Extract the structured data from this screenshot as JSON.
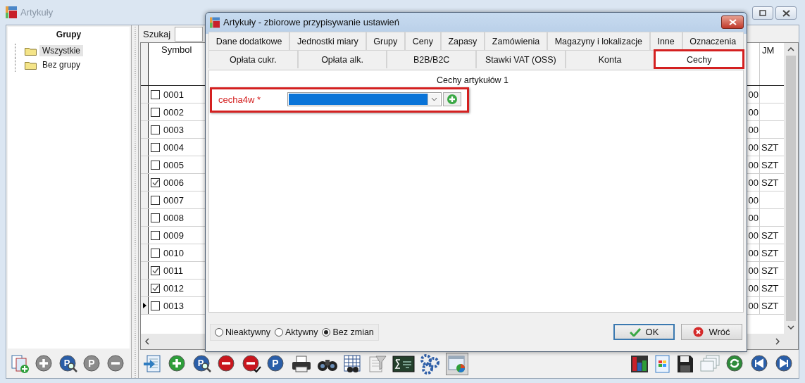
{
  "main_window": {
    "title": "Artykuły"
  },
  "groups_panel": {
    "title": "Grupy",
    "tree": [
      {
        "label": "Wszystkie",
        "selected": true
      },
      {
        "label": "Bez grupy",
        "selected": false
      }
    ]
  },
  "search": {
    "label": "Szukaj"
  },
  "table": {
    "columns": [
      "Symbol",
      "JM"
    ],
    "rows": [
      {
        "checked": false,
        "current": false,
        "symbol": "0001",
        "column_cut": "00"
      },
      {
        "checked": false,
        "current": false,
        "symbol": "0002",
        "column_cut": "00"
      },
      {
        "checked": false,
        "current": false,
        "symbol": "0003",
        "column_cut": "00"
      },
      {
        "checked": false,
        "current": false,
        "symbol": "0004",
        "column_cut": "00",
        "jm": "SZT"
      },
      {
        "checked": false,
        "current": false,
        "symbol": "0005",
        "column_cut": "00",
        "jm": "SZT"
      },
      {
        "checked": true,
        "current": false,
        "symbol": "0006",
        "column_cut": "00",
        "jm": "SZT"
      },
      {
        "checked": false,
        "current": false,
        "symbol": "0007",
        "column_cut": "00"
      },
      {
        "checked": false,
        "current": false,
        "symbol": "0008",
        "column_cut": "00"
      },
      {
        "checked": false,
        "current": false,
        "symbol": "0009",
        "column_cut": "00",
        "jm": "SZT"
      },
      {
        "checked": false,
        "current": false,
        "symbol": "0010",
        "column_cut": "00",
        "jm": "SZT"
      },
      {
        "checked": true,
        "current": false,
        "symbol": "0011",
        "column_cut": "00",
        "jm": "SZT"
      },
      {
        "checked": true,
        "current": false,
        "symbol": "0012",
        "column_cut": "00",
        "jm": "SZT"
      },
      {
        "checked": false,
        "current": true,
        "symbol": "0013",
        "column_cut": "00",
        "jm": "SZT"
      }
    ]
  },
  "groups_toolbar": [
    {
      "kind": "document-add",
      "disabled": false
    },
    {
      "kind": "plus",
      "disabled": true
    },
    {
      "kind": "p-search",
      "text": "P",
      "disabled": false
    },
    {
      "kind": "p",
      "text": "P",
      "disabled": true
    },
    {
      "kind": "minus",
      "disabled": true
    }
  ],
  "toolbar_left": [
    {
      "kind": "import"
    },
    {
      "kind": "plus"
    },
    {
      "kind": "p-search",
      "text": "P"
    },
    {
      "kind": "minus"
    },
    {
      "kind": "minus-check"
    },
    {
      "kind": "p",
      "text": "P"
    },
    {
      "kind": "printer"
    },
    {
      "kind": "binoculars"
    },
    {
      "kind": "table"
    },
    {
      "kind": "filter"
    },
    {
      "kind": "formula"
    },
    {
      "kind": "gears"
    },
    {
      "kind": "window-chart",
      "pressed": true
    }
  ],
  "toolbar_right": [
    {
      "kind": "bar-chart"
    },
    {
      "kind": "spreadsheet"
    },
    {
      "kind": "save"
    },
    {
      "kind": "windows"
    },
    {
      "kind": "refresh"
    },
    {
      "kind": "first"
    },
    {
      "kind": "last"
    }
  ],
  "dialog": {
    "title": "Artykuły - zbiorowe przypisywanie ustawień",
    "tabs_row1": [
      {
        "label": "Dane dodatkowe",
        "selected": false
      },
      {
        "label": "Jednostki miary",
        "selected": false
      },
      {
        "label": "Grupy",
        "selected": false
      },
      {
        "label": "Ceny",
        "selected": false
      },
      {
        "label": "Zapasy",
        "selected": false
      },
      {
        "label": "Zamówienia",
        "selected": false
      },
      {
        "label": "Magazyny i lokalizacje",
        "selected": false
      },
      {
        "label": "Inne",
        "selected": false
      },
      {
        "label": "Oznaczenia",
        "selected": false
      }
    ],
    "tabs_row2": [
      {
        "label": "Opłata cukr.",
        "selected": false,
        "highlighted": false
      },
      {
        "label": "Opłata alk.",
        "selected": false,
        "highlighted": false
      },
      {
        "label": "B2B/B2C",
        "selected": false,
        "highlighted": false
      },
      {
        "label": "Stawki VAT (OSS)",
        "selected": false,
        "highlighted": false
      },
      {
        "label": "Konta",
        "selected": false,
        "highlighted": false
      },
      {
        "label": "Cechy",
        "selected": true,
        "highlighted": true
      }
    ],
    "group_title": "Cechy artykułów 1",
    "field": {
      "label": "cecha4w *",
      "highlighted": true,
      "focused": true
    },
    "status_options": [
      {
        "label": "Nieaktywny",
        "selected": false
      },
      {
        "label": "Aktywny",
        "selected": false
      },
      {
        "label": "Bez zmian",
        "selected": true
      }
    ],
    "buttons": [
      {
        "label": "OK",
        "kind": "ok",
        "default": true
      },
      {
        "label": "Wróć",
        "kind": "back",
        "default": false
      }
    ]
  }
}
